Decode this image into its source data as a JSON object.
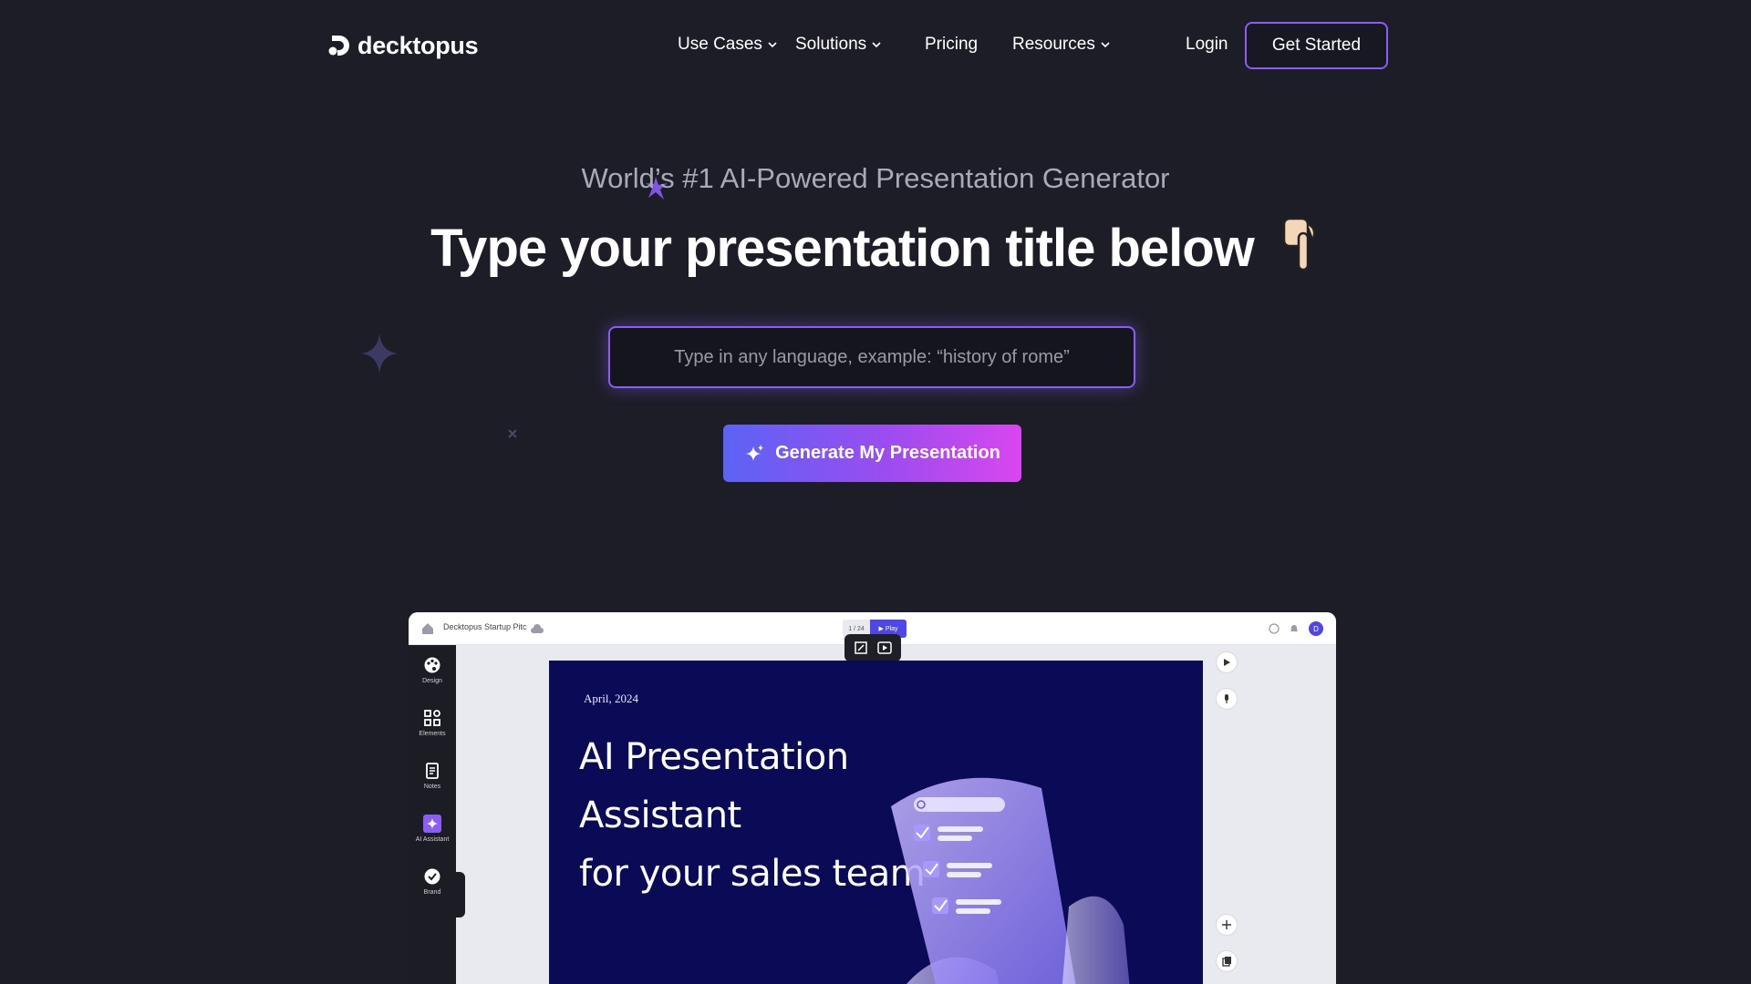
{
  "nav": {
    "logo_text": "decktopus",
    "items": [
      {
        "label": "Use Cases",
        "has_dropdown": true
      },
      {
        "label": "Solutions",
        "has_dropdown": true
      },
      {
        "label": "Pricing",
        "has_dropdown": false
      },
      {
        "label": "Resources",
        "has_dropdown": true
      }
    ],
    "login_label": "Login",
    "get_started_label": "Get Started"
  },
  "hero": {
    "eyebrow": "World’s #1 AI-Powered Presentation Generator",
    "headline": "Type your presentation title below",
    "prompt_placeholder": "Type in any language, example: “history of rome”",
    "prompt_value": "",
    "generate_label": "Generate My Presentation"
  },
  "preview": {
    "doc_title": "Decktopus Startup Pitc",
    "page_indicator": "1 / 24",
    "play_label": "▶ Play",
    "avatar_initial": "D",
    "tools": [
      {
        "label": "Design",
        "icon": "palette-icon"
      },
      {
        "label": "Elements",
        "icon": "grid-icon"
      },
      {
        "label": "Notes",
        "icon": "notes-icon"
      },
      {
        "label": "AI Assistant",
        "icon": "sparkle-icon"
      },
      {
        "label": "Brand",
        "icon": "badge-check-icon"
      }
    ],
    "slide": {
      "date": "April, 2024",
      "title_line1": "AI Presentation Assistant",
      "title_line2": "for your sales team"
    }
  },
  "colors": {
    "background": "#1d1d27",
    "accent": "#8b5cf6",
    "gradient_start": "#5b63f5",
    "gradient_end": "#d946ef",
    "slide_bg": "#0b0a57"
  }
}
